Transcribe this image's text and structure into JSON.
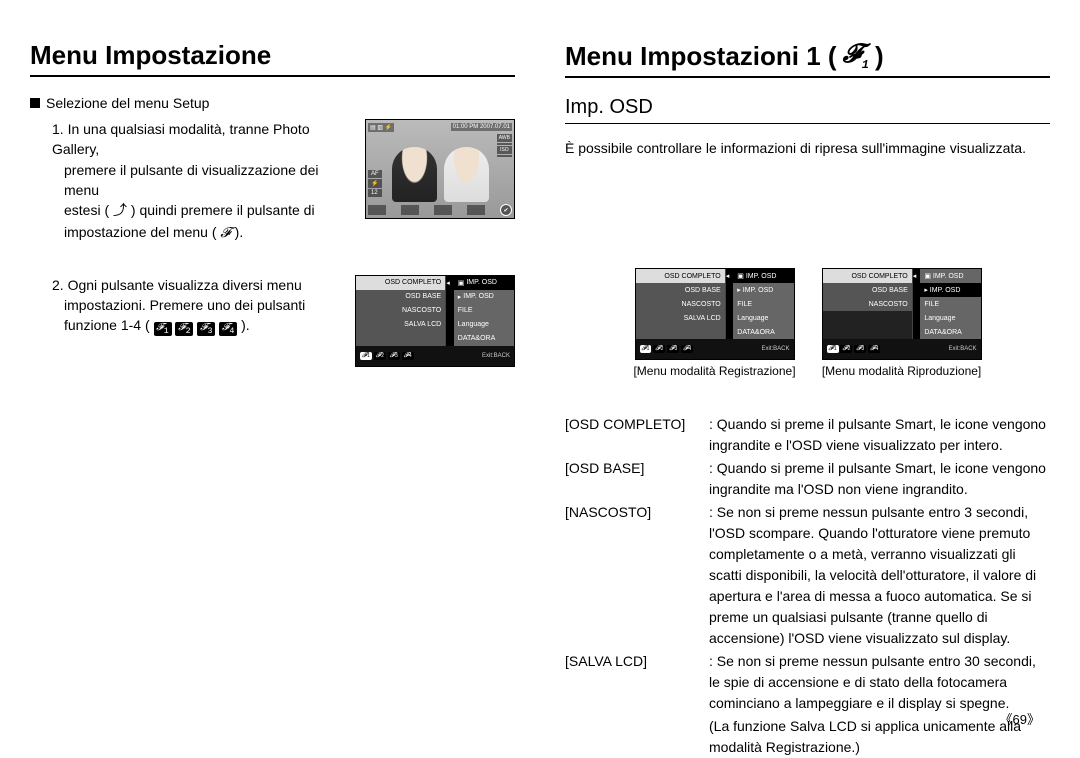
{
  "left": {
    "title": "Menu Impostazione",
    "section_label": "Selezione del menu Setup",
    "step1_line1": "1. In una qualsiasi modalità, tranne Photo Gallery,",
    "step1_line2": "premere il pulsante di visualizzazione dei menu",
    "step1_line3a": "estesi ( ",
    "step1_line3b": " ) quindi premere il pulsante di",
    "step1_line4a": "impostazione del menu ( ",
    "step1_line4b": " ).",
    "step2_line1": "2. Ogni pulsante visualizza diversi menu",
    "step2_line2": "impostazioni. Premere uno dei pulsanti",
    "step2_line3a": "funzione 1-4 ( ",
    "step2_line3b": " ).",
    "lcd": {
      "time": "01:00 PM 2007.07.01",
      "af": "AF",
      "flash": "⚡",
      "count": "12",
      "right_vals": [
        "AWB",
        "",
        "ISO",
        "",
        ""
      ]
    }
  },
  "right": {
    "title_pre": "Menu Impostazioni 1 ( ",
    "title_post": " )",
    "title_icon_sub": "1",
    "subheading": "Imp. OSD",
    "intro": "È possibile controllare le informazioni di ripresa sull'immagine visualizzata.",
    "caption_left": "[Menu modalità Registrazione]",
    "caption_right": "[Menu modalità Riproduzione]",
    "defs": [
      {
        "term": "[OSD COMPLETO]",
        "desc": ": Quando si preme il pulsante Smart, le icone vengono ingrandite e l'OSD viene visualizzato per intero."
      },
      {
        "term": "[OSD BASE]",
        "desc": ": Quando si preme il pulsante Smart, le icone vengono ingrandite ma l'OSD non viene ingrandito."
      },
      {
        "term": "[NASCOSTO]",
        "desc": ": Se non si preme nessun pulsante entro 3 secondi, l'OSD scompare. Quando l'otturatore viene premuto completamente o a metà, verranno visualizzati gli scatti disponibili, la velocità dell'otturatore, il valore di apertura e l'area di messa a fuoco automatica.   Se si preme un qualsiasi pulsante (tranne quello di accensione) l'OSD viene visualizzato sul display."
      },
      {
        "term": "[SALVA LCD]",
        "desc": ": Se non si preme nessun pulsante entro 30 secondi, le spie di accensione e di stato della fotocamera cominciano a lampeggiare e il display si spegne."
      }
    ],
    "note": "(La funzione Salva LCD si applica unicamente alla modalità Registrazione.)"
  },
  "menu": {
    "left_items": [
      "OSD COMPLETO",
      "OSD BASE",
      "NASCOSTO",
      "SALVA LCD",
      ""
    ],
    "right_items": [
      "IMP. OSD",
      "IMP. OSD",
      "FILE",
      "Language",
      "DATA&ORA"
    ],
    "exit": "Exit:BACK",
    "tab_glyph": "✔",
    "wrench_glyph": "𝓕"
  },
  "page_number": "《69》",
  "icons": {
    "arrow_up_glyph": "⤴",
    "wrench_glyph": "𝓕",
    "arrow_left": "◂",
    "camera": "▣",
    "play": "▸"
  }
}
